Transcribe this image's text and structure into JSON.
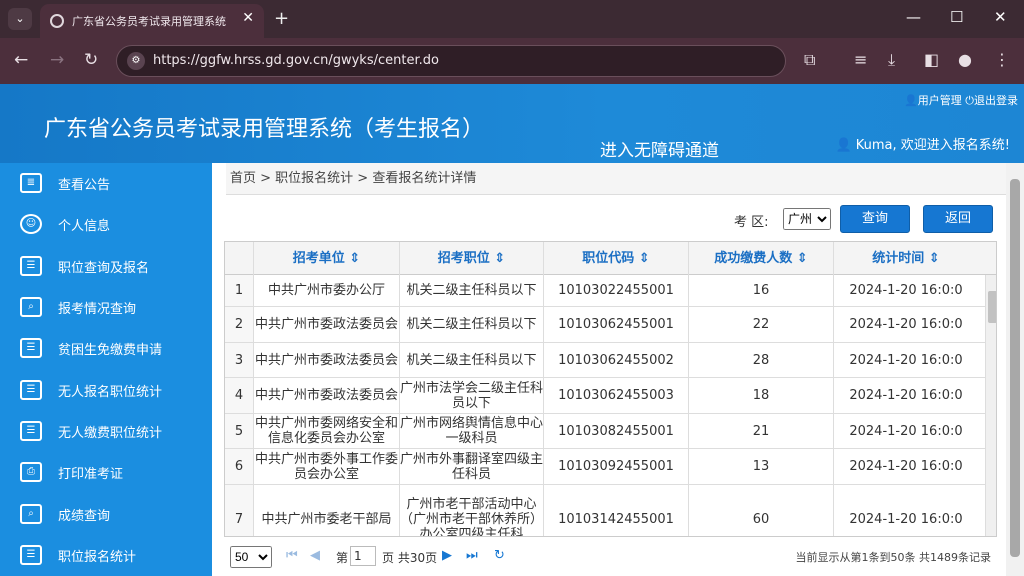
{
  "browser": {
    "tab_title": "广东省公务员考试录用管理系统",
    "url": "https://ggfw.hrss.gd.gov.cn/gwyks/center.do"
  },
  "header": {
    "title": "广东省公务员考试录用管理系统（考生报名）",
    "barrier_link": "进入无障碍通道",
    "user_mgmt": "用户管理",
    "logout": "退出登录",
    "welcome": "Kuma, 欢迎进入报名系统!"
  },
  "sidebar": {
    "items": [
      {
        "label": "查看公告",
        "icon": "notice-icon"
      },
      {
        "label": "个人信息",
        "icon": "user-icon"
      },
      {
        "label": "职位查询及报名",
        "icon": "form-icon"
      },
      {
        "label": "报考情况查询",
        "icon": "search-doc-icon"
      },
      {
        "label": "贫困生免缴费申请",
        "icon": "form-icon"
      },
      {
        "label": "无人报名职位统计",
        "icon": "form-icon"
      },
      {
        "label": "无人缴费职位统计",
        "icon": "form-icon"
      },
      {
        "label": "打印准考证",
        "icon": "printer-icon"
      },
      {
        "label": "成绩查询",
        "icon": "search-doc-icon"
      },
      {
        "label": "职位报名统计",
        "icon": "form-icon"
      }
    ]
  },
  "breadcrumb": "首页 > 职位报名统计 > 查看报名统计详情",
  "query": {
    "label": "考 区:",
    "region": "广州",
    "search_btn": "查询",
    "back_btn": "返回"
  },
  "table": {
    "headers": [
      "招考单位 ⇕",
      "招考职位 ⇕",
      "职位代码 ⇕",
      "成功缴费人数 ⇕",
      "统计时间 ⇕"
    ],
    "rows": [
      {
        "n": "1",
        "unit": "中共广州市委办公厅",
        "pos": "机关二级主任科员以下",
        "code": "10103022455001",
        "count": "16",
        "time": "2024-1-20 16:0:0"
      },
      {
        "n": "2",
        "unit": "中共广州市委政法委员会",
        "pos": "机关二级主任科员以下",
        "code": "10103062455001",
        "count": "22",
        "time": "2024-1-20 16:0:0"
      },
      {
        "n": "3",
        "unit": "中共广州市委政法委员会",
        "pos": "机关二级主任科员以下",
        "code": "10103062455002",
        "count": "28",
        "time": "2024-1-20 16:0:0"
      },
      {
        "n": "4",
        "unit": "中共广州市委政法委员会",
        "pos": "广州市法学会二级主任科员以下",
        "code": "10103062455003",
        "count": "18",
        "time": "2024-1-20 16:0:0"
      },
      {
        "n": "5",
        "unit": "中共广州市委网络安全和信息化委员会办公室",
        "pos": "广州市网络舆情信息中心一级科员",
        "code": "10103082455001",
        "count": "21",
        "time": "2024-1-20 16:0:0"
      },
      {
        "n": "6",
        "unit": "中共广州市委外事工作委员会办公室",
        "pos": "广州市外事翻译室四级主任科员",
        "code": "10103092455001",
        "count": "13",
        "time": "2024-1-20 16:0:0"
      },
      {
        "n": "7",
        "unit": "中共广州市委老干部局",
        "pos": "广州市老干部活动中心（广州市老干部休养所）办公室四级主任科",
        "code": "10103142455001",
        "count": "60",
        "time": "2024-1-20 16:0:0"
      }
    ]
  },
  "pager": {
    "page_size": "50",
    "page_prefix": "第",
    "page": "1",
    "page_suffix": "页 共30页",
    "info": "当前显示从第1条到50条 共1489条记录"
  }
}
